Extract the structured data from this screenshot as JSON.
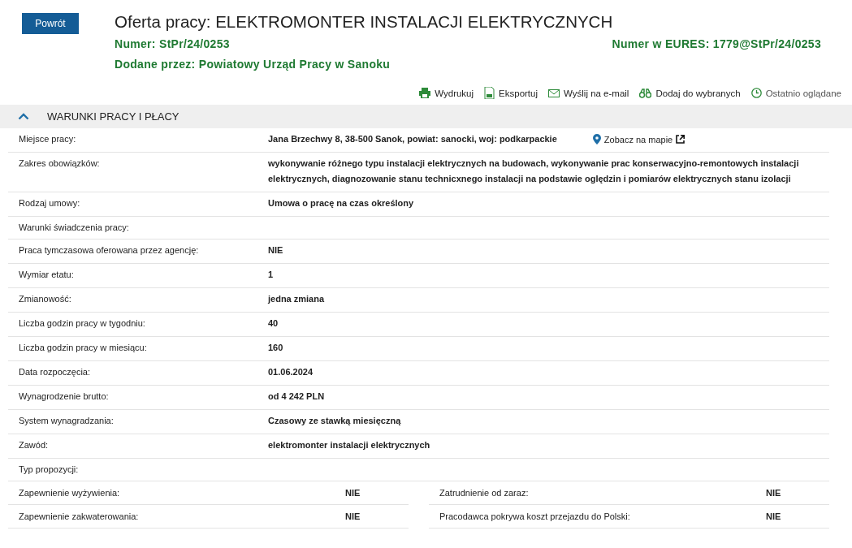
{
  "back_button": "Powrót",
  "title": "Oferta pracy: ELEKTROMONTER INSTALACJI ELEKTRYCZNYCH",
  "number": {
    "label": "Numer:",
    "value": "StPr/24/0253"
  },
  "eures": {
    "label": "Numer w EURES:",
    "value": "1779@StPr/24/0253"
  },
  "added_by": {
    "label": "Dodane przez:",
    "value": "Powiatowy Urząd Pracy w Sanoku"
  },
  "actions": [
    {
      "kind": "print",
      "label": "Wydrukuj"
    },
    {
      "kind": "export",
      "label": "Eksportuj"
    },
    {
      "kind": "email",
      "label": "Wyślij na e-mail"
    },
    {
      "kind": "favorite",
      "label": "Dodaj do wybranych"
    },
    {
      "kind": "recent",
      "label": "Ostatnio oglądane"
    }
  ],
  "section": {
    "title": "WARUNKI PRACY I PŁACY",
    "expanded": true
  },
  "rows": [
    {
      "label": "Miejsce pracy:",
      "value": "Jana Brzechwy 8, 38-500 Sanok, powiat: sanocki, woj: podkarpackie",
      "map_link": "Zobacz na mapie"
    },
    {
      "label": "Zakres obowiązków:",
      "value": "wykonywanie różnego typu instalacji elektrycznych na budowach, wykonywanie prac konserwacyjno-remontowych instalacji elektrycznych, diagnozowanie stanu technicxnego instalacji na podstawie oględzin i pomiarów elektrycznych stanu izolacji"
    },
    {
      "label": "Rodzaj umowy:",
      "value": "Umowa o pracę na czas określony"
    },
    {
      "label": "Warunki świadczenia pracy:"
    },
    {
      "label": "Praca tymczasowa oferowana przez agencję:",
      "value": "NIE"
    },
    {
      "label": "Wymiar etatu:",
      "value": "1"
    },
    {
      "label": "Zmianowość:",
      "value": "jedna zmiana"
    },
    {
      "label": "Liczba godzin pracy w tygodniu:",
      "value": "40"
    },
    {
      "label": "Liczba godzin pracy w miesiącu:",
      "value": "160"
    },
    {
      "label": "Data rozpoczęcia:",
      "value": "01.06.2024"
    },
    {
      "label": "Wynagrodzenie brutto:",
      "value": "od 4 242 PLN"
    },
    {
      "label": "System wynagradzania:",
      "value": "Czasowy ze stawką miesięczną"
    },
    {
      "label": "Zawód:",
      "value": "elektromonter instalacji elektrycznych"
    },
    {
      "label": "Typ propozycji:"
    }
  ],
  "pairs": [
    [
      {
        "label": "Zapewnienie wyżywienia:",
        "value": "NIE"
      },
      {
        "label": "Zatrudnienie od zaraz:",
        "value": "NIE"
      }
    ],
    [
      {
        "label": "Zapewnienie zakwaterowania:",
        "value": "NIE"
      },
      {
        "label": "Pracodawca pokrywa koszt przejazdu do Polski:",
        "value": "NIE"
      }
    ]
  ]
}
